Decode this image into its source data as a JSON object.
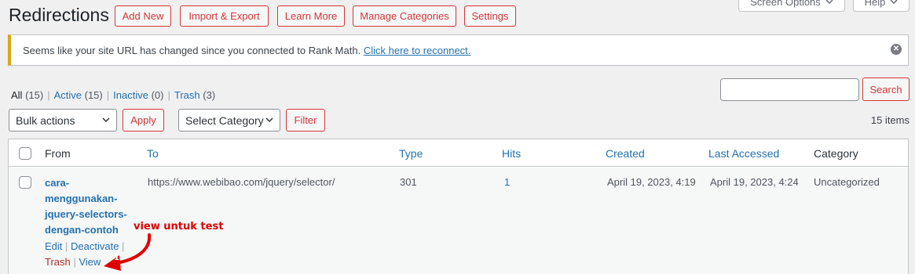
{
  "header": {
    "title": "Redirections",
    "buttons": [
      "Add New",
      "Import & Export",
      "Learn More",
      "Manage Categories",
      "Settings"
    ],
    "screen_options": "Screen Options",
    "help": "Help"
  },
  "notice": {
    "text": "Seems like your site URL has changed since you connected to Rank Math.",
    "link": "Click here to reconnect."
  },
  "filters": {
    "views": [
      {
        "label": "All",
        "count": "(15)"
      },
      {
        "label": "Active",
        "count": "(15)"
      },
      {
        "label": "Inactive",
        "count": "(0)"
      },
      {
        "label": "Trash",
        "count": "(3)"
      }
    ],
    "bulk_actions": "Bulk actions",
    "apply": "Apply",
    "category": "Select Category",
    "filter": "Filter",
    "search_button": "Search",
    "search_value": "",
    "items_count": "15 items"
  },
  "table": {
    "columns": [
      "From",
      "To",
      "Type",
      "Hits",
      "Created",
      "Last Accessed",
      "Category"
    ],
    "row": {
      "from": "cara-menggunakan-jquery-selectors-dengan-contoh",
      "to": "https://www.webibao.com/jquery/selector/",
      "type": "301",
      "hits": "1",
      "created": "April 19, 2023, 4:19",
      "last_accessed": "April 19, 2023, 4:24",
      "category": "Uncategorized",
      "actions": {
        "edit": "Edit",
        "deactivate": "Deactivate",
        "trash": "Trash",
        "view": "View"
      }
    }
  },
  "annotation": {
    "text": "view untuk test",
    "marker": "1",
    "color": "#e00000"
  }
}
